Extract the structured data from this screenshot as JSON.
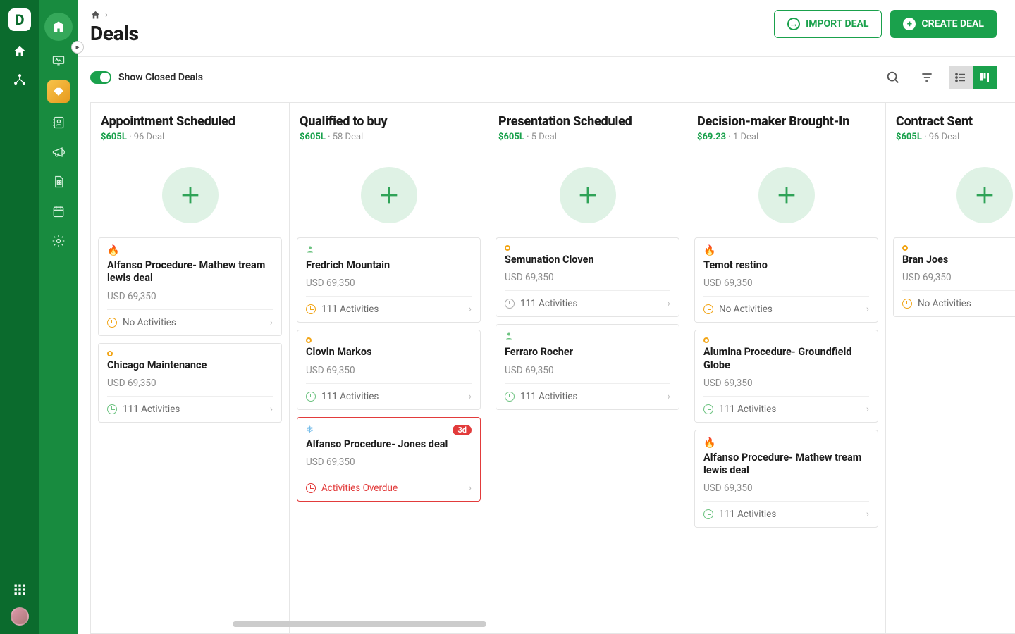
{
  "colors": {
    "brand": "#1aa14c",
    "rail_dark": "#0b6b2d",
    "rail_light": "#188b3f",
    "danger": "#e23b3b",
    "warn": "#f2a516"
  },
  "rail": {
    "logo_letter": "D"
  },
  "breadcrumb": {
    "home_aria": "Home"
  },
  "page_title": "Deals",
  "header_actions": {
    "import_label": "IMPORT DEAL",
    "create_label": "CREATE DEAL"
  },
  "toolbar": {
    "toggle_label": "Show Closed Deals"
  },
  "columns": [
    {
      "title": "Appointment Scheduled",
      "amount": "$605L",
      "count": "96 Deal",
      "cards": [
        {
          "icon": "flame",
          "title": "Alfanso Procedure- Mathew tream lewis deal",
          "amount": "USD 69,350",
          "activity": "No Activities",
          "activity_style": "warn"
        },
        {
          "icon": "dot",
          "title": "Chicago Maintenance",
          "amount": "USD 69,350",
          "activity": "111 Activities",
          "activity_style": "ok"
        }
      ]
    },
    {
      "title": "Qualified to buy",
      "amount": "$605L",
      "count": "58 Deal",
      "cards": [
        {
          "icon": "person",
          "title": "Fredrich Mountain",
          "amount": "USD 69,350",
          "activity": "111 Activities",
          "activity_style": "warn"
        },
        {
          "icon": "dot",
          "title": "Clovin Markos",
          "amount": "USD 69,350",
          "activity": "111 Activities",
          "activity_style": "ok"
        },
        {
          "icon": "snow",
          "title": "Alfanso Procedure- Jones  deal",
          "amount": "USD 69,350",
          "activity": "Activities Overdue",
          "activity_style": "red",
          "badge": "3d",
          "overdue": true
        }
      ]
    },
    {
      "title": "Presentation Scheduled",
      "amount": "$605L",
      "count": "5 Deal",
      "cards": [
        {
          "icon": "dot",
          "title": "Semunation  Cloven",
          "amount": "USD 69,350",
          "activity": "111 Activities",
          "activity_style": "grey"
        },
        {
          "icon": "person",
          "title": "Ferraro Rocher",
          "amount": "USD 69,350",
          "activity": "111 Activities",
          "activity_style": "ok"
        }
      ]
    },
    {
      "title": "Decision-maker Brought-In",
      "amount": "$69.23",
      "count": "1 Deal",
      "cards": [
        {
          "icon": "flame",
          "title": "Temot restino",
          "amount": "USD 69,350",
          "activity": "No Activities",
          "activity_style": "warn"
        },
        {
          "icon": "dot",
          "title": "Alumina Procedure- Groundfield Globe",
          "amount": "USD 69,350",
          "activity": "111 Activities",
          "activity_style": "ok"
        },
        {
          "icon": "flame",
          "title": "Alfanso Procedure- Mathew tream lewis deal",
          "amount": "USD 69,350",
          "activity": "111 Activities",
          "activity_style": "ok"
        }
      ]
    },
    {
      "title": "Contract Sent",
      "amount": "$605L",
      "count": "96 Deal",
      "cards": [
        {
          "icon": "dot",
          "title": "Bran Joes",
          "amount": "USD 69,350",
          "activity": "No Activities",
          "activity_style": "warn"
        }
      ]
    }
  ]
}
